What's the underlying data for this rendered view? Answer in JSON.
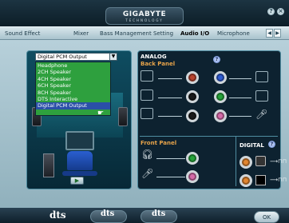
{
  "app": {
    "brand": "GIGABYTE",
    "brand_sub": "TECHNOLOGY"
  },
  "window_controls": {
    "help_glyph": "?",
    "close_glyph": "×"
  },
  "tabs": [
    {
      "label": "Sound Effect"
    },
    {
      "label": "Mixer"
    },
    {
      "label": "Bass Management Setting"
    },
    {
      "label": "Audio I/O",
      "active": true
    },
    {
      "label": "Microphone"
    }
  ],
  "output_select": {
    "value": "Digital PCM Output",
    "options": [
      "Headphone",
      "2CH Speaker",
      "4CH Speaker",
      "6CH Speaker",
      "8CH Speaker",
      "DTS Interactive",
      "Digital PCM Output"
    ],
    "selected_index": 6
  },
  "analog": {
    "title": "ANALOG",
    "subtitle": "Back Panel"
  },
  "front": {
    "subtitle": "Front Panel"
  },
  "digital": {
    "title": "DIGITAL"
  },
  "jack_colors": {
    "orange": "#e0852f",
    "blue": "#2f5cd1",
    "green": "#26a33a",
    "pink": "#d56aa8",
    "black": "#1a1a1a",
    "red": "#b8442f"
  },
  "footer": {
    "dts_logo_text": "dts",
    "ok_label": "OK"
  },
  "icons": [
    "speaker-icon",
    "headphone-icon",
    "microphone-icon",
    "spdif-icon"
  ]
}
